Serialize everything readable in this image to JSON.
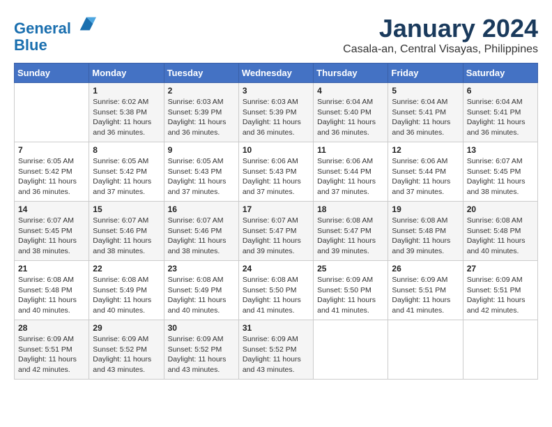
{
  "header": {
    "logo_line1": "General",
    "logo_line2": "Blue",
    "month_title": "January 2024",
    "location": "Casala-an, Central Visayas, Philippines"
  },
  "weekdays": [
    "Sunday",
    "Monday",
    "Tuesday",
    "Wednesday",
    "Thursday",
    "Friday",
    "Saturday"
  ],
  "weeks": [
    [
      {
        "day": "",
        "info": ""
      },
      {
        "day": "1",
        "info": "Sunrise: 6:02 AM\nSunset: 5:38 PM\nDaylight: 11 hours\nand 36 minutes."
      },
      {
        "day": "2",
        "info": "Sunrise: 6:03 AM\nSunset: 5:39 PM\nDaylight: 11 hours\nand 36 minutes."
      },
      {
        "day": "3",
        "info": "Sunrise: 6:03 AM\nSunset: 5:39 PM\nDaylight: 11 hours\nand 36 minutes."
      },
      {
        "day": "4",
        "info": "Sunrise: 6:04 AM\nSunset: 5:40 PM\nDaylight: 11 hours\nand 36 minutes."
      },
      {
        "day": "5",
        "info": "Sunrise: 6:04 AM\nSunset: 5:41 PM\nDaylight: 11 hours\nand 36 minutes."
      },
      {
        "day": "6",
        "info": "Sunrise: 6:04 AM\nSunset: 5:41 PM\nDaylight: 11 hours\nand 36 minutes."
      }
    ],
    [
      {
        "day": "7",
        "info": "Sunrise: 6:05 AM\nSunset: 5:42 PM\nDaylight: 11 hours\nand 36 minutes."
      },
      {
        "day": "8",
        "info": "Sunrise: 6:05 AM\nSunset: 5:42 PM\nDaylight: 11 hours\nand 37 minutes."
      },
      {
        "day": "9",
        "info": "Sunrise: 6:05 AM\nSunset: 5:43 PM\nDaylight: 11 hours\nand 37 minutes."
      },
      {
        "day": "10",
        "info": "Sunrise: 6:06 AM\nSunset: 5:43 PM\nDaylight: 11 hours\nand 37 minutes."
      },
      {
        "day": "11",
        "info": "Sunrise: 6:06 AM\nSunset: 5:44 PM\nDaylight: 11 hours\nand 37 minutes."
      },
      {
        "day": "12",
        "info": "Sunrise: 6:06 AM\nSunset: 5:44 PM\nDaylight: 11 hours\nand 37 minutes."
      },
      {
        "day": "13",
        "info": "Sunrise: 6:07 AM\nSunset: 5:45 PM\nDaylight: 11 hours\nand 38 minutes."
      }
    ],
    [
      {
        "day": "14",
        "info": "Sunrise: 6:07 AM\nSunset: 5:45 PM\nDaylight: 11 hours\nand 38 minutes."
      },
      {
        "day": "15",
        "info": "Sunrise: 6:07 AM\nSunset: 5:46 PM\nDaylight: 11 hours\nand 38 minutes."
      },
      {
        "day": "16",
        "info": "Sunrise: 6:07 AM\nSunset: 5:46 PM\nDaylight: 11 hours\nand 38 minutes."
      },
      {
        "day": "17",
        "info": "Sunrise: 6:07 AM\nSunset: 5:47 PM\nDaylight: 11 hours\nand 39 minutes."
      },
      {
        "day": "18",
        "info": "Sunrise: 6:08 AM\nSunset: 5:47 PM\nDaylight: 11 hours\nand 39 minutes."
      },
      {
        "day": "19",
        "info": "Sunrise: 6:08 AM\nSunset: 5:48 PM\nDaylight: 11 hours\nand 39 minutes."
      },
      {
        "day": "20",
        "info": "Sunrise: 6:08 AM\nSunset: 5:48 PM\nDaylight: 11 hours\nand 40 minutes."
      }
    ],
    [
      {
        "day": "21",
        "info": "Sunrise: 6:08 AM\nSunset: 5:48 PM\nDaylight: 11 hours\nand 40 minutes."
      },
      {
        "day": "22",
        "info": "Sunrise: 6:08 AM\nSunset: 5:49 PM\nDaylight: 11 hours\nand 40 minutes."
      },
      {
        "day": "23",
        "info": "Sunrise: 6:08 AM\nSunset: 5:49 PM\nDaylight: 11 hours\nand 40 minutes."
      },
      {
        "day": "24",
        "info": "Sunrise: 6:08 AM\nSunset: 5:50 PM\nDaylight: 11 hours\nand 41 minutes."
      },
      {
        "day": "25",
        "info": "Sunrise: 6:09 AM\nSunset: 5:50 PM\nDaylight: 11 hours\nand 41 minutes."
      },
      {
        "day": "26",
        "info": "Sunrise: 6:09 AM\nSunset: 5:51 PM\nDaylight: 11 hours\nand 41 minutes."
      },
      {
        "day": "27",
        "info": "Sunrise: 6:09 AM\nSunset: 5:51 PM\nDaylight: 11 hours\nand 42 minutes."
      }
    ],
    [
      {
        "day": "28",
        "info": "Sunrise: 6:09 AM\nSunset: 5:51 PM\nDaylight: 11 hours\nand 42 minutes."
      },
      {
        "day": "29",
        "info": "Sunrise: 6:09 AM\nSunset: 5:52 PM\nDaylight: 11 hours\nand 43 minutes."
      },
      {
        "day": "30",
        "info": "Sunrise: 6:09 AM\nSunset: 5:52 PM\nDaylight: 11 hours\nand 43 minutes."
      },
      {
        "day": "31",
        "info": "Sunrise: 6:09 AM\nSunset: 5:52 PM\nDaylight: 11 hours\nand 43 minutes."
      },
      {
        "day": "",
        "info": ""
      },
      {
        "day": "",
        "info": ""
      },
      {
        "day": "",
        "info": ""
      }
    ]
  ]
}
